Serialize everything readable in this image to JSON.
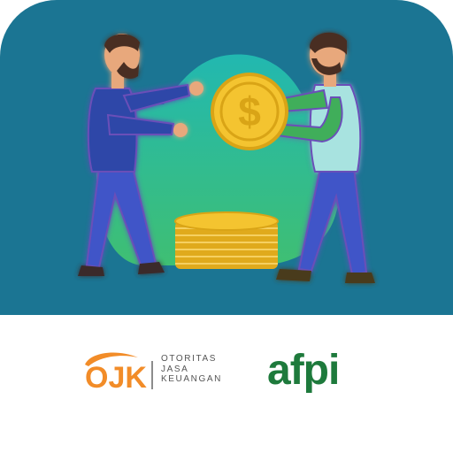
{
  "app_icon": {
    "name": "money-exchange-app-icon",
    "colors": {
      "background": "#1b7593",
      "blob_top": "#21b6a8",
      "blob_bottom": "#3fbf73",
      "coin": "#f4c430",
      "coin_dark": "#d9a416",
      "logo_bar": "#ffffff"
    },
    "illustration": {
      "coin_symbol": "$"
    }
  },
  "logos": {
    "ojk": {
      "mark": "OJK",
      "lines": [
        "OTORITAS",
        "JASA",
        "KEUANGAN"
      ],
      "colors": {
        "mark": "#f28c28",
        "text": "#555555"
      }
    },
    "afpi": {
      "mark": "afpi",
      "color": "#1e7a3c"
    }
  }
}
